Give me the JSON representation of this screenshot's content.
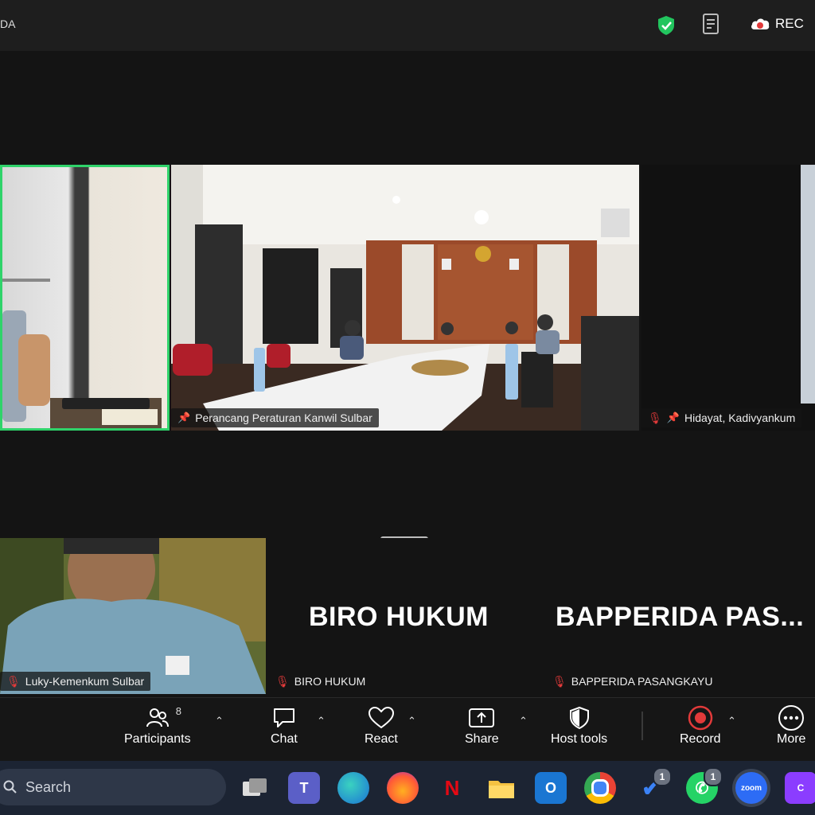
{
  "window": {
    "title_fragment": "DA",
    "rec_label": "REC"
  },
  "participants": {
    "tile1": {
      "name": ""
    },
    "tile2": {
      "name": "Perancang Peraturan Kanwil Sulbar"
    },
    "tile3": {
      "name": "Hidayat, Kadivyankum"
    },
    "tile4": {
      "name": "Luky-Kemenkum Sulbar"
    },
    "tile5": {
      "display": "BIRO HUKUM",
      "name": "BIRO HUKUM"
    },
    "tile6": {
      "display": "BAPPERIDA  PAS...",
      "name": "BAPPERIDA PASANGKAYU"
    }
  },
  "toolbar": {
    "participants_label": "Participants",
    "participants_count": "8",
    "chat_label": "Chat",
    "react_label": "React",
    "share_label": "Share",
    "host_tools_label": "Host tools",
    "record_label": "Record",
    "more_label": "More"
  },
  "taskbar": {
    "search_placeholder": "Search",
    "apps": [
      "task-view",
      "teams",
      "edge",
      "firefox",
      "netflix",
      "file-explorer",
      "outlook",
      "chrome",
      "todo",
      "whatsapp",
      "zoom",
      "canva"
    ],
    "todo_badge": "1",
    "whatsapp_badge": "1"
  },
  "colors": {
    "active_speaker": "#2fd36a",
    "record_red": "#e23a3a",
    "shield_green": "#22c55e"
  }
}
